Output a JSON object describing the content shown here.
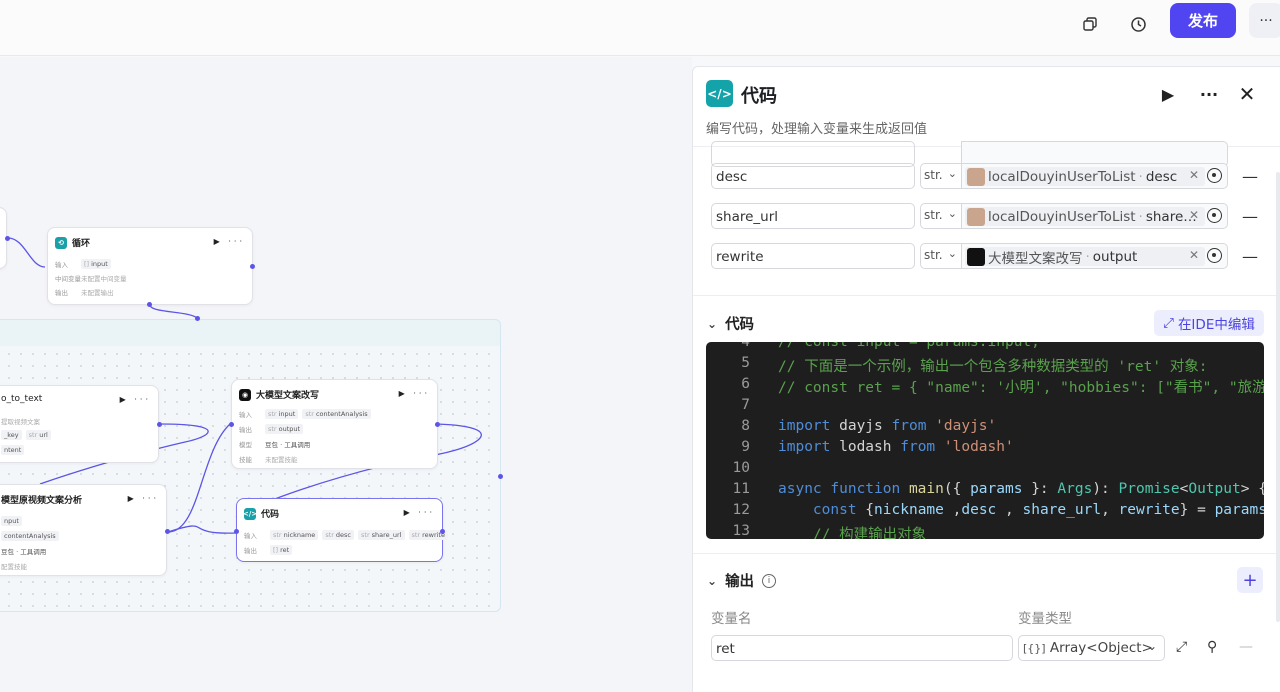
{
  "topbar": {
    "copy_icon": "copy-icon",
    "history_icon": "history-icon",
    "publish_label": "发布",
    "more_label": "···"
  },
  "canvas": {
    "nodes": {
      "loop": {
        "title": "循环",
        "input_label": "输入",
        "input_tag": "input",
        "mid_label": "中间变量",
        "mid_value": "未配置中间变量",
        "out_label": "输出",
        "out_value": "未配置输出"
      },
      "video": {
        "title": "o_to_text",
        "line1": "提取视频文案",
        "tag1": "_key",
        "tag2": "url",
        "tag3": "ntent"
      },
      "analysis": {
        "title": "模型原视频文案分析",
        "tag_in": "nput",
        "tag_out": "contentAnalysis",
        "model": "豆包 · 工具调用",
        "skill": "配置技能"
      },
      "rewrite": {
        "title": "大模型文案改写",
        "in_label": "输入",
        "in_tag1": "input",
        "in_tag2": "contentAnalysis",
        "out_label": "输出",
        "out_tag": "output",
        "model_label": "模型",
        "model_value": "豆包 · 工具调用",
        "skill_label": "技能",
        "skill_value": "未配置技能"
      },
      "code": {
        "title": "代码",
        "in_label": "输入",
        "in_tags": [
          "nickname",
          "desc",
          "share_url",
          "rewrite"
        ],
        "out_label": "输出",
        "out_tag": "ret"
      }
    }
  },
  "panel": {
    "title": "代码",
    "description": "编写代码，处理输入变量来生成返回值",
    "inputs": [
      {
        "name": "desc",
        "type": "str.",
        "ref_node": "localDouyinUserToList",
        "ref_field": "desc",
        "avatar": "photo"
      },
      {
        "name": "share_url",
        "type": "str.",
        "ref_node": "localDouyinUserToList",
        "ref_field": "share…",
        "avatar": "photo"
      },
      {
        "name": "rewrite",
        "type": "str.",
        "ref_node": "大模型文案改写",
        "ref_field": "output",
        "avatar": "black"
      }
    ],
    "code_section": {
      "title": "代码",
      "ide_label": "在IDE中编辑",
      "lines": [
        {
          "n": "4",
          "text": "// const input = params.input;"
        },
        {
          "n": "5",
          "text": "// 下面是一个示例，输出一个包含多种数据类型的 'ret' 对象:"
        },
        {
          "n": "6",
          "text": "// const ret = { \"name\": '小明', \"hobbies\": [\"看书\", \"旅游"
        },
        {
          "n": "7",
          "text": ""
        },
        {
          "n": "8",
          "text": "import dayjs from 'dayjs'"
        },
        {
          "n": "9",
          "text": "import lodash from 'lodash'"
        },
        {
          "n": "10",
          "text": ""
        },
        {
          "n": "11",
          "text": "async function main({ params }: Args): Promise<Output> {"
        },
        {
          "n": "12",
          "text": "    const {nickname ,desc , share_url, rewrite} = params;"
        },
        {
          "n": "13",
          "text": "    // 构建输出对象"
        }
      ]
    },
    "output_section": {
      "title": "输出",
      "col_name": "变量名",
      "col_type": "变量类型",
      "var_name": "ret",
      "var_type": "Array<Object>",
      "type_icon": "[{}]"
    }
  }
}
